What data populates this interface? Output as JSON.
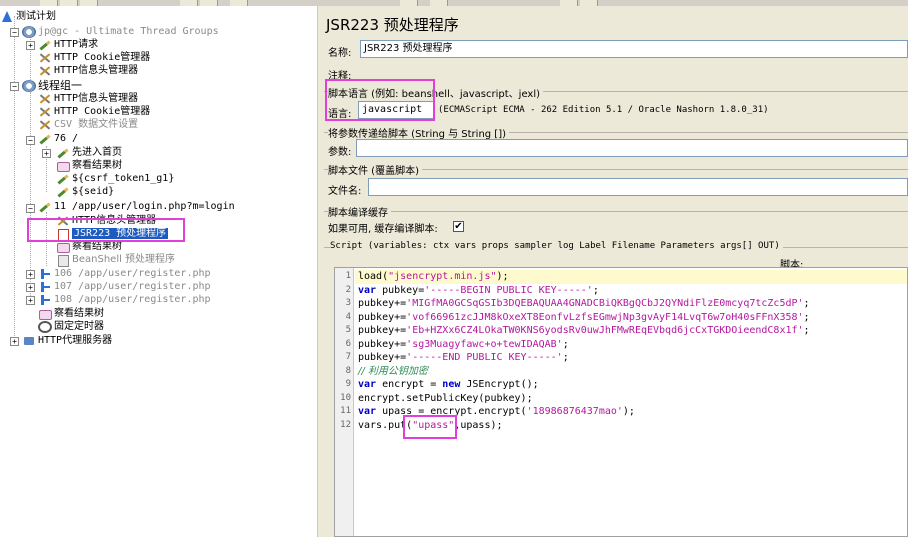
{
  "tree": {
    "root": "测试计划",
    "thread_group": "jp@gc - Ultimate Thread Groups",
    "tg_http_request": "HTTP请求",
    "tg_cookie": "HTTP Cookie管理器",
    "tg_header": "HTTP信息头管理器",
    "thread_group2": "线程组一",
    "g2_header": "HTTP信息头管理器",
    "g2_cookie": "HTTP Cookie管理器",
    "g2_csv": "CSV 数据文件设置",
    "s76": "76 /",
    "s76_first": "先进入首页",
    "s76_results": "察看结果树",
    "s76_csrf": "${csrf_token1_g1}",
    "s76_seid": "${seid}",
    "s11": "11 /app/user/login.php?m=login",
    "s11_header": "HTTP信息头管理器",
    "s11_jsr": "JSR223 预处理程序",
    "s11_results": "察看结果树",
    "s11_beanshell": "BeanShell 预处理程序",
    "s106": "106 /app/user/register.php",
    "s107": "107 /app/user/register.php",
    "s108": "108 /app/user/register.php",
    "g2_results": "察看结果树",
    "g2_timer": "固定定时器",
    "proxy": "HTTP代理服务器"
  },
  "panel": {
    "title": "JSR223 预处理程序",
    "name_label": "名称:",
    "name_value": "JSR223 预处理程序",
    "comment_label": "注释:",
    "lang_group": "脚本语言 (例如: beanshell、javascript、jexl)",
    "lang_label": "语言:",
    "lang_value": "javascript",
    "lang_engine": "(ECMAScript ECMA - 262 Edition 5.1 / Oracle Nashorn 1.8.0_31)",
    "params_group": "将参数传递给脚本 (String 与 String [])",
    "params_label": "参数:",
    "file_group": "脚本文件 (覆盖脚本)",
    "file_label": "文件名:",
    "cache_group": "脚本编译缓存",
    "cache_label": "如果可用, 缓存编译脚本:",
    "cache_checked": "✔",
    "script_group": "Script (variables: ctx vars props sampler log Label Filename Parameters args[] OUT)",
    "script_header": "脚本:"
  },
  "code": {
    "line_numbers": [
      "1",
      "2",
      "3",
      "4",
      "5",
      "6",
      "7",
      "8",
      "9",
      "10",
      "11",
      "12"
    ],
    "l1a": "load(",
    "l1b": "\"jsencrypt.min.js\"",
    "l1c": ");",
    "l2a": "var",
    "l2b": " pubkey=",
    "l2c": "'-----BEGIN PUBLIC KEY-----'",
    "l2d": ";",
    "l3a": "pubkey+=",
    "l3b": "'MIGfMA0GCSqGSIb3DQEBAQUAA4GNADCBiQKBgQCbJ2QYNdiFlzE0mcyq7tcZc5dP'",
    "l3c": ";",
    "l4a": "pubkey+=",
    "l4b": "'vof66961zcJJM8kOxeXT8EonfvLzfsEGmwjNp3gvAyF14LvqT6w7oH40sFFnX358'",
    "l4c": ";",
    "l5a": "pubkey+=",
    "l5b": "'Eb+HZXx6CZ4LOkaTW0KNS6yodsRv0uwJhFMwREqEVbqd6jcCxTGKDOieendC8x1f'",
    "l5c": ";",
    "l6a": "pubkey+=",
    "l6b": "'sg3Muagyfawc+o+tewIDAQAB'",
    "l6c": ";",
    "l7a": "pubkey+=",
    "l7b": "'-----END PUBLIC KEY-----'",
    "l7c": ";",
    "l8": "// 利用公钥加密",
    "l9a": "var",
    "l9b": " encrypt = ",
    "l9c": "new",
    "l9d": " JSEncrypt();",
    "l10": "encrypt.setPublicKey(pubkey);",
    "l11a": "var",
    "l11b": " upass = encrypt.encrypt(",
    "l11c": "'18986876437mao'",
    "l11d": ");",
    "l12a": "vars.put(",
    "l12b": "\"upass\"",
    "l12c": ",upass);"
  },
  "colors": {
    "highlight": "#e040d8",
    "keyword": "#0000c8",
    "string": "#b5179e",
    "comment": "#2e8b57",
    "selection": "#1c5bbf"
  }
}
